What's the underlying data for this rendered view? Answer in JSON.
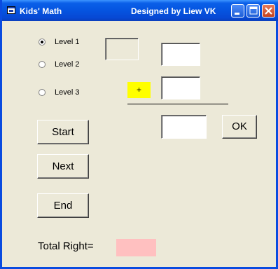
{
  "window": {
    "title_left": "Kids' Math",
    "title_right": "Designed by Liew VK"
  },
  "levels": [
    {
      "label": "Level  1",
      "selected": true
    },
    {
      "label": "Level 2",
      "selected": false
    },
    {
      "label": "Level 3",
      "selected": false
    }
  ],
  "problem": {
    "operator": "+",
    "operand1": "",
    "operand2": "",
    "answer": "",
    "result_display": ""
  },
  "buttons": {
    "ok": "OK",
    "start": "Start",
    "next": "Next",
    "end": "End"
  },
  "score": {
    "label": "Total Right=",
    "value": ""
  },
  "colors": {
    "titlebar": "#0554e0",
    "operator_bg": "#ffff00",
    "score_bg": "#ffc0c0",
    "form_bg": "#ece9d8"
  }
}
